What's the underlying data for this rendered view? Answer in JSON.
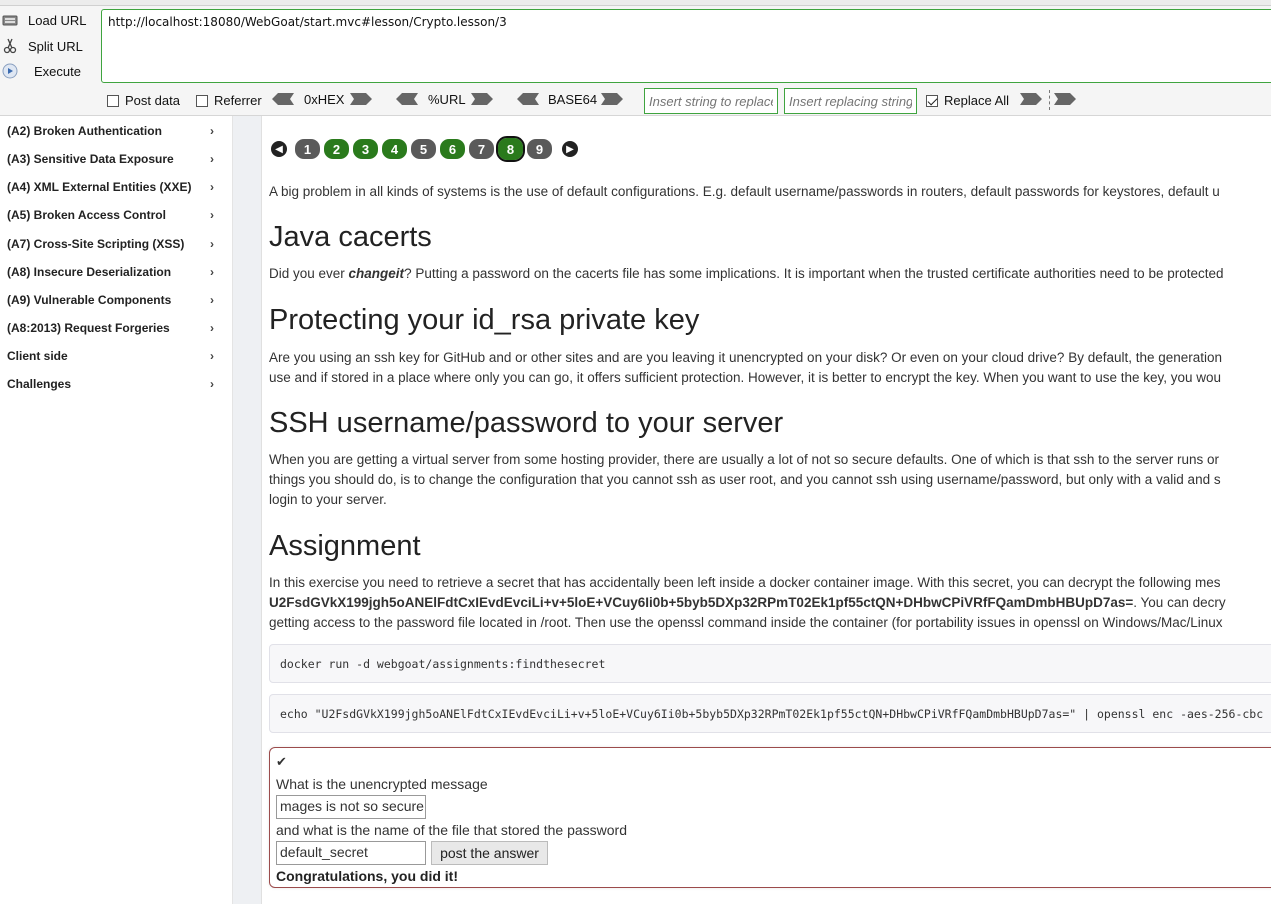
{
  "hackbar": {
    "load_url": "Load URL",
    "split_url": "Split URL",
    "execute": "Execute",
    "url_value": "http://localhost:18080/WebGoat/start.mvc#lesson/Crypto.lesson/3",
    "post_data": "Post data",
    "referrer": "Referrer",
    "hex": "0xHEX",
    "url_enc": "%URL",
    "base64": "BASE64",
    "insert_placeholder": "Insert string to replace",
    "replacing_placeholder": "Insert replacing string",
    "replace_all": "Replace All",
    "post_data_checked": false,
    "referrer_checked": false,
    "replace_all_checked": true
  },
  "sidebar": {
    "items": [
      {
        "label": "(A2) Broken Authentication"
      },
      {
        "label": "(A3) Sensitive Data Exposure"
      },
      {
        "label": "(A4) XML External Entities (XXE)"
      },
      {
        "label": "(A5) Broken Access Control"
      },
      {
        "label": "(A7) Cross-Site Scripting (XSS)"
      },
      {
        "label": "(A8) Insecure Deserialization"
      },
      {
        "label": "(A9) Vulnerable Components"
      },
      {
        "label": "(A8:2013) Request Forgeries"
      },
      {
        "label": "Client side"
      },
      {
        "label": "Challenges"
      }
    ],
    "chevron": "›"
  },
  "pager": {
    "prev": "◀",
    "next": "▶",
    "pages": [
      {
        "label": "1",
        "state": "gray"
      },
      {
        "label": "2",
        "state": "green"
      },
      {
        "label": "3",
        "state": "green"
      },
      {
        "label": "4",
        "state": "green"
      },
      {
        "label": "5",
        "state": "gray"
      },
      {
        "label": "6",
        "state": "green"
      },
      {
        "label": "7",
        "state": "gray"
      },
      {
        "label": "8",
        "state": "current"
      },
      {
        "label": "9",
        "state": "gray"
      }
    ]
  },
  "lesson": {
    "intro": "A big problem in all kinds of systems is the use of default configurations. E.g. default username/passwords in routers, default passwords for keystores, default u",
    "h_cacerts": "Java cacerts",
    "cacerts_pre": "Did you ever ",
    "cacerts_em": "changeit",
    "cacerts_post": "? Putting a password on the cacerts file has some implications. It is important when the trusted certificate authorities need to be protected",
    "h_idrsa": "Protecting your id_rsa private key",
    "idrsa_1": "Are you using an ssh key for GitHub and or other sites and are you leaving it unencrypted on your disk? Or even on your cloud drive? By default, the generation",
    "idrsa_2": "use and if stored in a place where only you can go, it offers sufficient protection. However, it is better to encrypt the key. When you want to use the key, you wou",
    "h_ssh": "SSH username/password to your server",
    "ssh_1": "When you are getting a virtual server from some hosting provider, there are usually a lot of not so secure defaults. One of which is that ssh to the server runs or",
    "ssh_2": "things you should do, is to change the configuration that you cannot ssh as user root, and you cannot ssh using username/password, but only with a valid and s",
    "ssh_3": "login to your server.",
    "h_assign": "Assignment",
    "assign_1": "In this exercise you need to retrieve a secret that has accidentally been left inside a docker container image. With this secret, you can decrypt the following mes",
    "assign_2_bold": "U2FsdGVkX199jgh5oANElFdtCxIEvdEvciLi+v+5loE+VCuy6Ii0b+5byb5DXp32RPmT02Ek1pf55ctQN+DHbwCPiVRfFQamDmbHBUpD7as=",
    "assign_2_post": ". You can decry",
    "assign_3": "getting access to the password file located in /root. Then use the openssl command inside the container (for portability issues in openssl on Windows/Mac/Linux",
    "code_1": "docker run -d webgoat/assignments:findthesecret",
    "code_2": "echo \"U2FsdGVkX199jgh5oANElFdtCxIEvdEvciLi+v+5loE+VCuy6Ii0b+5byb5DXp32RPmT02Ek1pf55ctQN+DHbwCPiVRfFQamDmbHBUpD7as=\" | openssl enc -aes-256-cbc"
  },
  "form": {
    "check_icon": "✔",
    "q1": "What is the unencrypted message",
    "a1": "mages is not so secure",
    "q2": "and what is the name of the file that stored the password",
    "a2": "default_secret",
    "submit": "post the answer",
    "result": "Congratulations, you did it!"
  },
  "colors": {
    "accent_green": "#3fa43f",
    "page_green": "#2a7a1c",
    "page_gray": "#5a5a5a",
    "assign_border": "#9b4b4b"
  }
}
